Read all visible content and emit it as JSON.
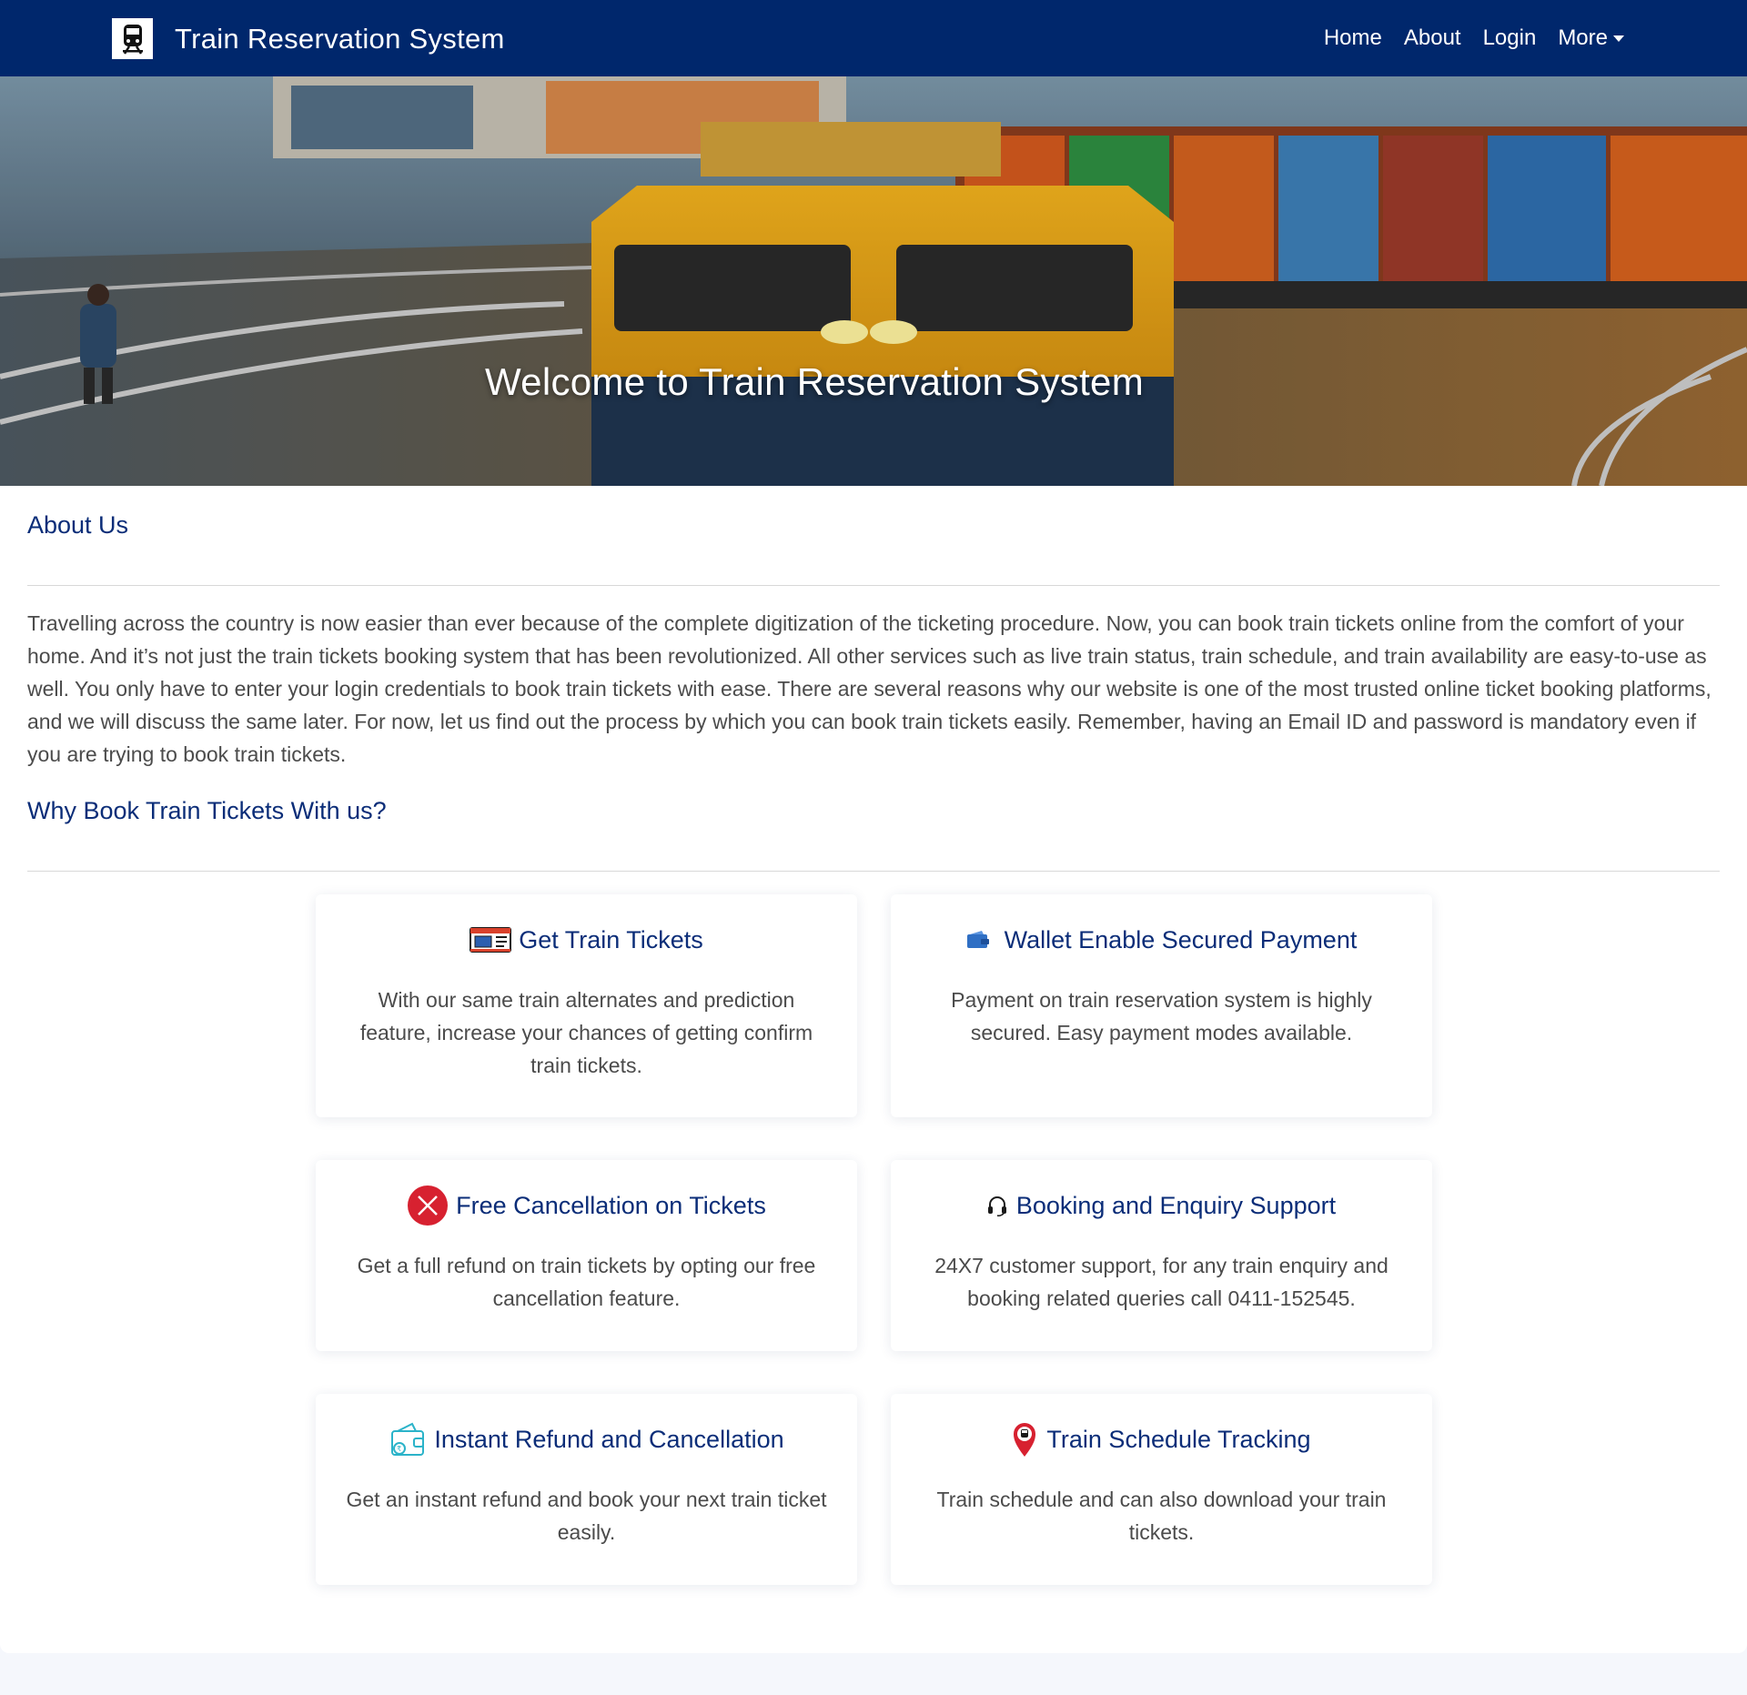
{
  "navbar": {
    "brand_title": "Train Reservation System",
    "brand_icon": "train-icon",
    "links": [
      "Home",
      "About",
      "Login",
      "More"
    ]
  },
  "hero": {
    "title": "Welcome to Train Reservation System"
  },
  "about": {
    "heading": "About Us",
    "text": "Travelling across the country is now easier than ever because of the complete digitization of the ticketing procedure. Now, you can book train tickets online from the comfort of your home. And it’s not just the train tickets booking system that has been revolutionized. All other services such as live train status, train schedule, and train availability are easy-to-use as well. You only have to enter your login credentials to book train tickets with ease. There are several reasons why our website is one of the most trusted online ticket booking platforms, and we will discuss the same later. For now, let us find out the process by which you can book train tickets easily. Remember, having an Email ID and password is mandatory even if you are trying to book train tickets."
  },
  "why": {
    "heading": "Why Book Train Tickets With us?"
  },
  "cards": [
    {
      "icon": "ticket-icon",
      "title": "Get Train Tickets",
      "text": "With our same train alternates and prediction feature, increase your chances of getting confirm train tickets."
    },
    {
      "icon": "wallet-icon",
      "title": "Wallet Enable Secured Payment",
      "text": "Payment on train reservation system is highly secured. Easy payment modes available."
    },
    {
      "icon": "cancel-icon",
      "title": "Free Cancellation on Tickets",
      "text": "Get a full refund on train tickets by opting our free cancellation feature."
    },
    {
      "icon": "headset-icon",
      "title": "Booking and Enquiry Support",
      "text": "24X7 customer support, for any train enquiry and booking related queries call 0411-152545."
    },
    {
      "icon": "refund-wallet-icon",
      "title": "Instant Refund and Cancellation",
      "text": "Get an instant refund and book your next train ticket easily."
    },
    {
      "icon": "location-pin-icon",
      "title": "Train Schedule Tracking",
      "text": "Train schedule and can also download your train tickets."
    }
  ],
  "colors": {
    "navbar": "#00276c",
    "heading": "#0b2d78",
    "text": "#4b4b4b",
    "page_bg": "#f5f7fc"
  }
}
